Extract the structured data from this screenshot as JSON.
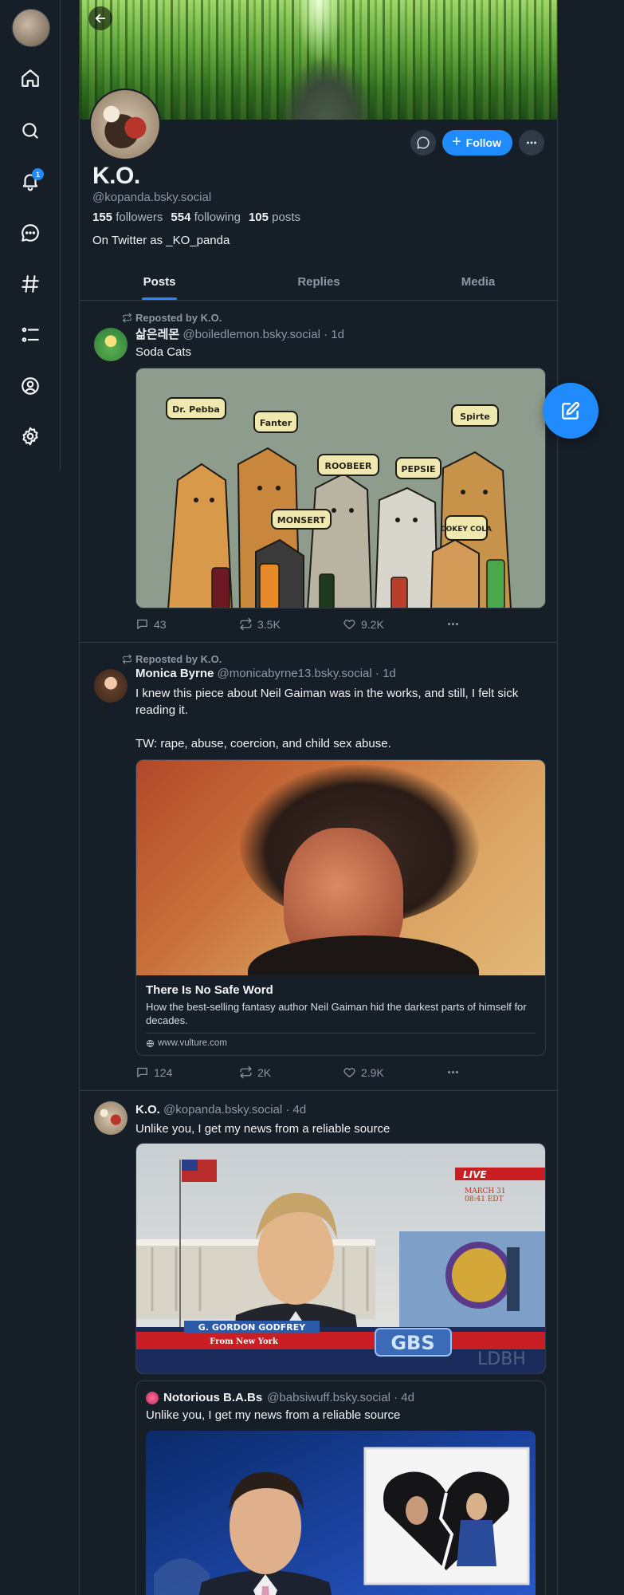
{
  "nav": {
    "notification_count": "1",
    "items": [
      "home-icon",
      "search-icon",
      "bell-icon",
      "chat-icon",
      "hashtag-icon",
      "list-icon",
      "profile-icon",
      "settings-icon"
    ]
  },
  "profile": {
    "display_name": "K.O.",
    "handle": "@kopanda.bsky.social",
    "followers_count": "155",
    "followers_label": "followers",
    "following_count": "554",
    "following_label": "following",
    "posts_count": "105",
    "posts_label": "posts",
    "bio": "On Twitter as _KO_panda",
    "follow_label": "Follow"
  },
  "tabs": [
    "Posts",
    "Replies",
    "Media"
  ],
  "posts": [
    {
      "repost_label": "Reposted by K.O.",
      "name": "삶은레몬",
      "meta": "@boiledlemon.bsky.social · 1d",
      "text": "Soda Cats",
      "image_labels": [
        "Dr. Pebba",
        "Fanter",
        "ROOBEER",
        "PEPSIE",
        "Spirte",
        "MONSERT",
        "COKEY COLA"
      ],
      "replies": "43",
      "reposts": "3.5K",
      "likes": "9.2K"
    },
    {
      "repost_label": "Reposted by K.O.",
      "name": "Monica Byrne",
      "meta": "@monicabyrne13.bsky.social · 1d",
      "text": "I knew this piece about Neil Gaiman was in the works, and still, I felt sick reading it.\n\nTW: rape, abuse, coercion, and child sex abuse.",
      "link_title": "There Is No Safe Word",
      "link_description": "How the best-selling fantasy author Neil Gaiman hid the darkest parts of himself for decades.",
      "link_domain": "www.vulture.com",
      "replies": "124",
      "reposts": "2K",
      "likes": "2.9K"
    },
    {
      "name": "K.O.",
      "meta": "@kopanda.bsky.social · 4d",
      "text": "Unlike you, I get my news from a reliable source",
      "image_live": "LIVE",
      "image_date": "MARCH 31",
      "image_time": "08:41 EDT",
      "image_name_banner": "G. GORDON GODFREY",
      "image_location": "From New York",
      "image_channel": "GBS",
      "image_watermark": "LDBH",
      "quote_name": "Notorious B.A.Bs",
      "quote_meta": "@babsiwuff.bsky.social · 4d",
      "quote_text": "Unlike you, I get my news from a reliable source"
    }
  ],
  "colors": {
    "accent": "#208bfe",
    "background": "#161e27",
    "border": "#2e3a47",
    "muted": "#8b98a5"
  }
}
